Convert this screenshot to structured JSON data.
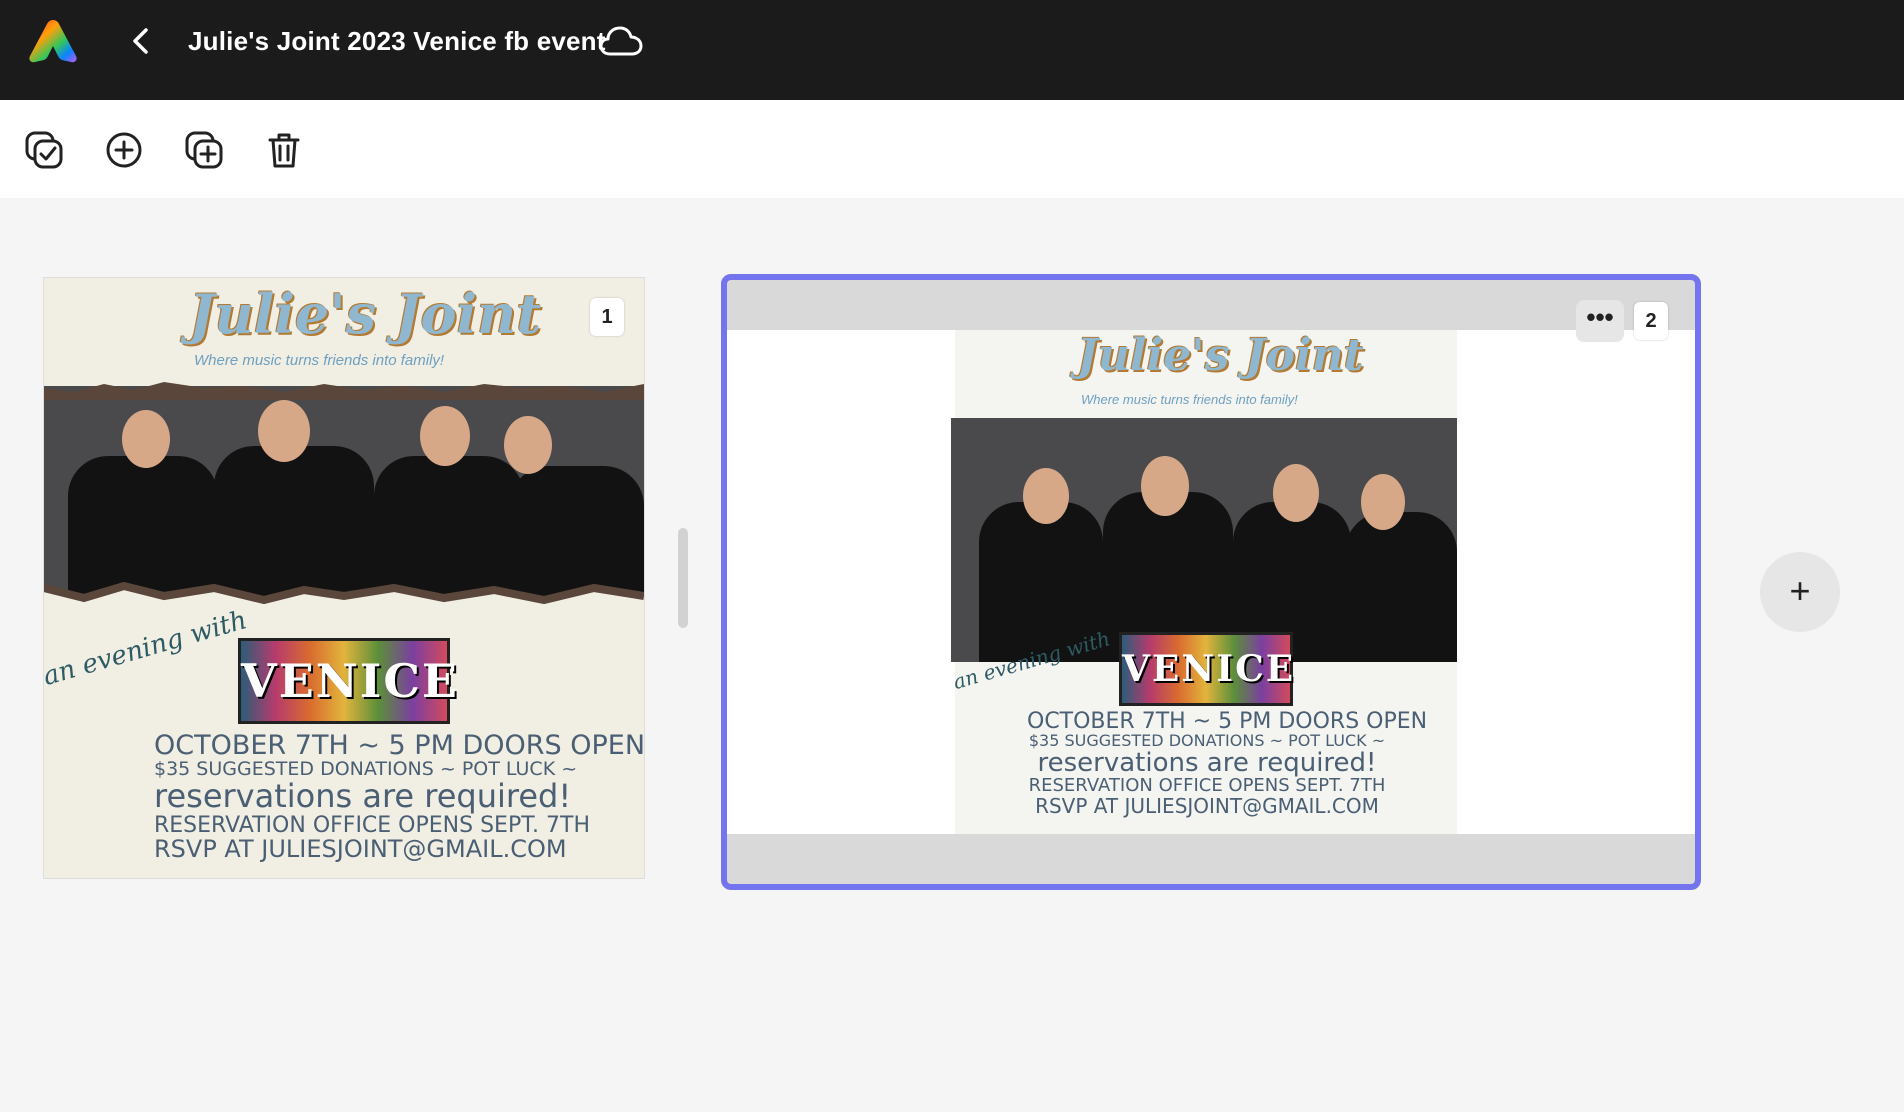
{
  "header": {
    "title": "Julie's Joint 2023 Venice fb event",
    "icons": [
      "adobe-express-logo",
      "chevron-left-icon",
      "cloud-icon"
    ]
  },
  "toolbar": {
    "tools": [
      "select-pages-icon",
      "add-page-icon",
      "duplicate-page-icon",
      "delete-icon"
    ]
  },
  "pages": [
    {
      "number": "1",
      "design": {
        "title": "Julie's Joint",
        "tagline": "Where music turns friends into family!",
        "script": "an evening with",
        "band": "VENICE",
        "lines": [
          "October 7th ~ 5 PM Doors Open",
          "$35 Suggested Donations ~ Pot Luck ~",
          "reservations are required!",
          "reservation office opens Sept. 7th",
          "RSVP at JULIESJOINT@GMAIL.COM"
        ]
      }
    },
    {
      "number": "2",
      "more_label": "•••",
      "design": {
        "title": "Julie's Joint",
        "tagline": "Where music turns friends into family!",
        "script": "an evening with",
        "band": "VENICE",
        "lines": [
          "October 7th ~ 5 PM Doors Open",
          "$35 Suggested Donations ~ Pot Luck ~",
          "reservations are required!",
          "reservation office opens Sept. 7th",
          "RSVP at JULIESJOINT@GMAIL.COM"
        ]
      }
    }
  ],
  "add_page_label": "+",
  "colors": {
    "header_bg": "#1b1b1b",
    "selection": "#7474ef",
    "canvas_bg": "#f5f5f5"
  }
}
